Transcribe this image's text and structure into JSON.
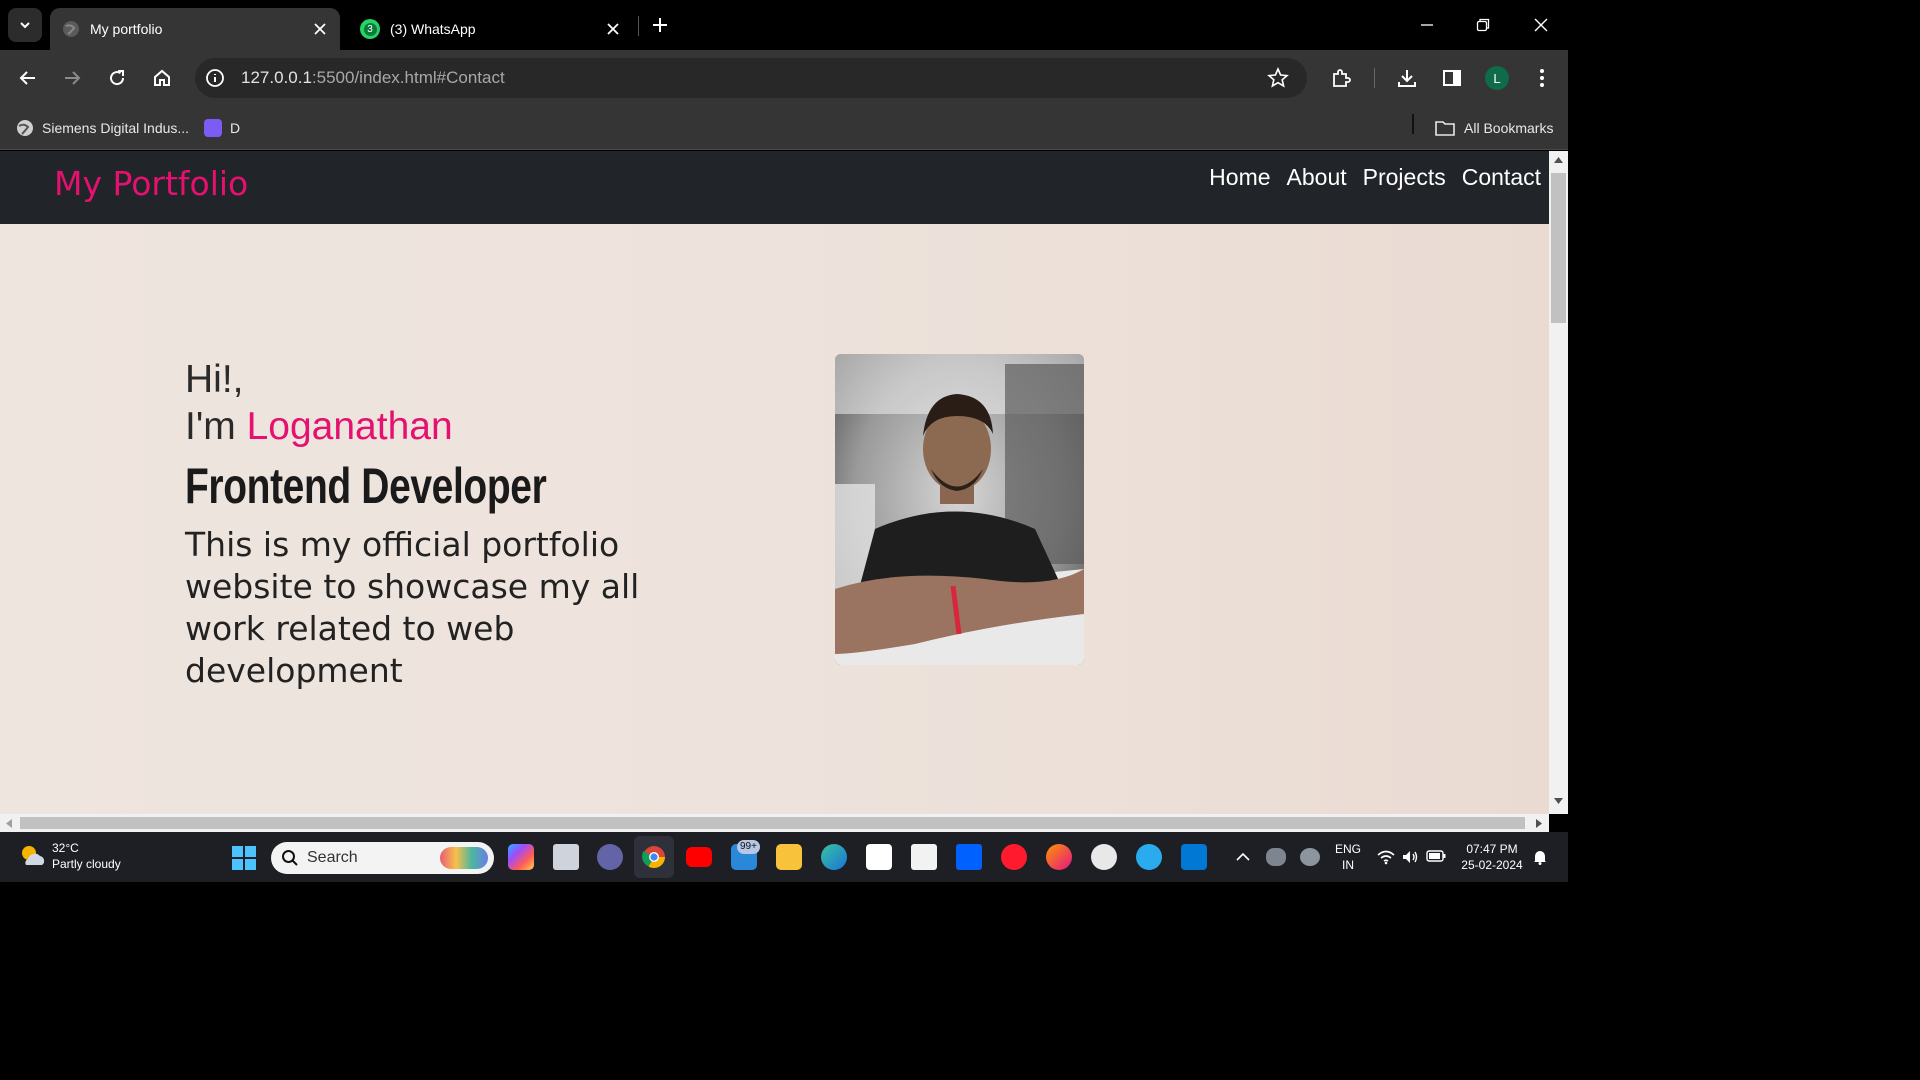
{
  "browser": {
    "tabs": [
      {
        "title": "My portfolio",
        "active": true
      },
      {
        "title": "(3) WhatsApp",
        "active": false,
        "badge": "3"
      }
    ],
    "url_host": "127.0.0.1",
    "url_rest": ":5500/index.html#Contact",
    "profile_initial": "L",
    "bookmarks": [
      {
        "label": "Siemens Digital Indus..."
      },
      {
        "label": "D"
      }
    ],
    "all_bookmarks_label": "All Bookmarks"
  },
  "site": {
    "logo": "My Portfolio",
    "nav": [
      "Home",
      "About",
      "Projects",
      "Contact"
    ],
    "greeting_line1": "Hi!,",
    "greeting_prefix": "I'm ",
    "name": "Loganathan",
    "role": "Frontend Developer",
    "description": "This is my official portfolio website to showcase my all work related to web development",
    "accent_color": "#e5106f"
  },
  "taskbar": {
    "temperature": "32°C",
    "weather": "Partly cloudy",
    "search_label": "Search",
    "mail_badge": "99+",
    "language_line1": "ENG",
    "language_line2": "IN",
    "time": "07:47 PM",
    "date": "25-02-2024"
  }
}
